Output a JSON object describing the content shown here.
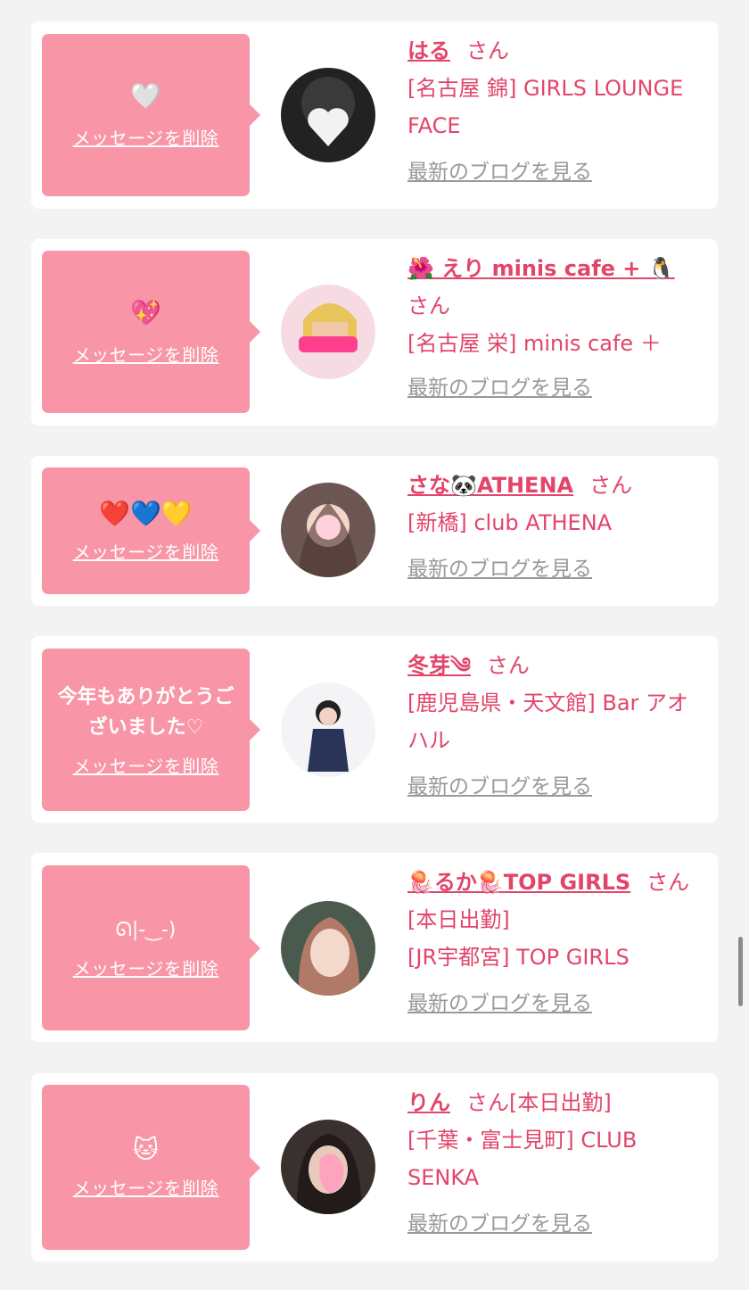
{
  "colors": {
    "accent": "#e2456a",
    "message_bg": "#f895a6",
    "blog_link": "#999999",
    "page_bg": "#f3f3f3"
  },
  "delete_label": "メッセージを削除",
  "blog_label": "最新のブログを見る",
  "san_label": "さん",
  "items": [
    {
      "message": "🤍",
      "avatar_icon": "heart-emoji",
      "name": "はる",
      "shop": "[名古屋 錦] GIRLS LOUNGE FACE"
    },
    {
      "message": "💖",
      "avatar_icon": "girl-photo",
      "name": "🌺 えり minis cafe + 🐧",
      "shop": "[名古屋 栄] minis cafe ＋"
    },
    {
      "message": "❤️💙💛",
      "avatar_icon": "girl-photo",
      "name": "さな🐼ATHENA",
      "shop": "[新橋] club ATHENA"
    },
    {
      "message": "今年もありがとうございました♡",
      "avatar_icon": "girl-photo",
      "name": "冬芽༄",
      "shop": "[鹿児島県・天文館] Bar アオハル"
    },
    {
      "message": "ᘏ|-‿-)",
      "avatar_icon": "girl-photo",
      "name": "🪼るか🪼TOP GIRLS",
      "status": "[本日出勤]",
      "shop": "[JR宇都宮] TOP GIRLS"
    },
    {
      "message": "🐱",
      "avatar_icon": "girl-photo",
      "name": "りん",
      "status": "[本日出勤]",
      "shop": "[千葉・富士見町] CLUB SENKA"
    }
  ]
}
